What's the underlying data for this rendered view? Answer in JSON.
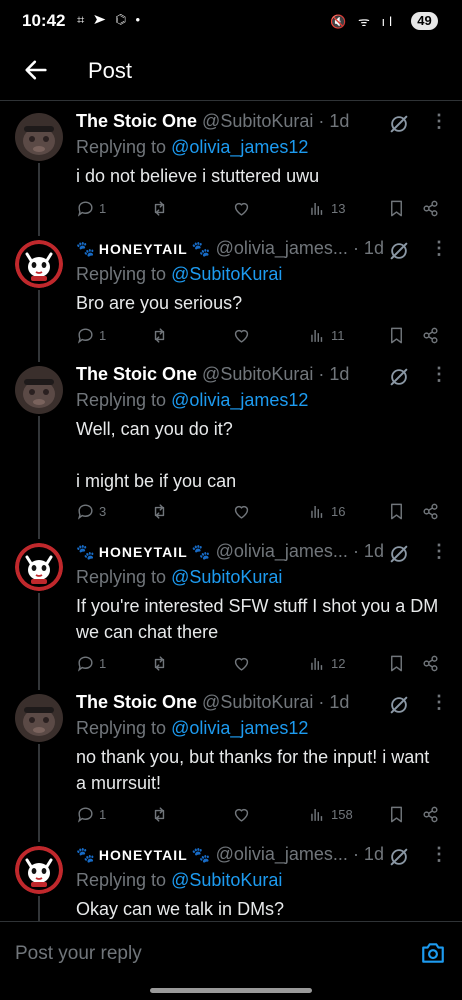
{
  "status_bar": {
    "time": "10:42",
    "left_icons": "⌗ ➤ ⌬ •",
    "right_icons": "🔇 ᯤ ıl",
    "battery": "49"
  },
  "header": {
    "title": "Post"
  },
  "tweets": [
    {
      "name": "The Stoic One",
      "handle": "@SubitoKurai",
      "time": "· 1d",
      "reply_prefix": "Replying to ",
      "reply_to": "@olivia_james12",
      "lines": [
        "i do not believe i stuttered uwu"
      ],
      "replies": "1",
      "views": "13",
      "avatar": "stoic"
    },
    {
      "name": "HONEYTAIL",
      "handle": "@olivia_james...",
      "time": "· 1d",
      "reply_prefix": "Replying to ",
      "reply_to": "@SubitoKurai",
      "lines": [
        "Bro are you serious?"
      ],
      "replies": "1",
      "views": "11",
      "avatar": "honey"
    },
    {
      "name": "The Stoic One",
      "handle": "@SubitoKurai",
      "time": "· 1d",
      "reply_prefix": "Replying to ",
      "reply_to": "@olivia_james12",
      "lines": [
        "Well, can you do it?",
        "",
        "i might be if you can"
      ],
      "replies": "3",
      "views": "16",
      "avatar": "stoic"
    },
    {
      "name": "HONEYTAIL",
      "handle": "@olivia_james...",
      "time": "· 1d",
      "reply_prefix": "Replying to ",
      "reply_to": "@SubitoKurai",
      "lines": [
        "If you're interested SFW stuff I shot you a DM",
        "we can chat there"
      ],
      "replies": "1",
      "views": "12",
      "avatar": "honey"
    },
    {
      "name": "The Stoic One",
      "handle": "@SubitoKurai",
      "time": "· 1d",
      "reply_prefix": "Replying to ",
      "reply_to": "@olivia_james12",
      "lines": [
        "no thank you, but thanks for the input! i want",
        "a murrsuit!"
      ],
      "replies": "1",
      "views": "158",
      "avatar": "stoic"
    },
    {
      "name": "HONEYTAIL",
      "handle": "@olivia_james...",
      "time": "· 1d",
      "reply_prefix": "Replying to ",
      "reply_to": "@SubitoKurai",
      "lines": [
        "Okay can we talk in DMs?"
      ],
      "replies": "",
      "views": "",
      "avatar": "honey"
    }
  ],
  "composer": {
    "placeholder": "Post your reply"
  },
  "colors": {
    "accent": "#1d9bf0",
    "muted": "#71767b",
    "text": "#e7e9ea",
    "background": "#000000"
  }
}
